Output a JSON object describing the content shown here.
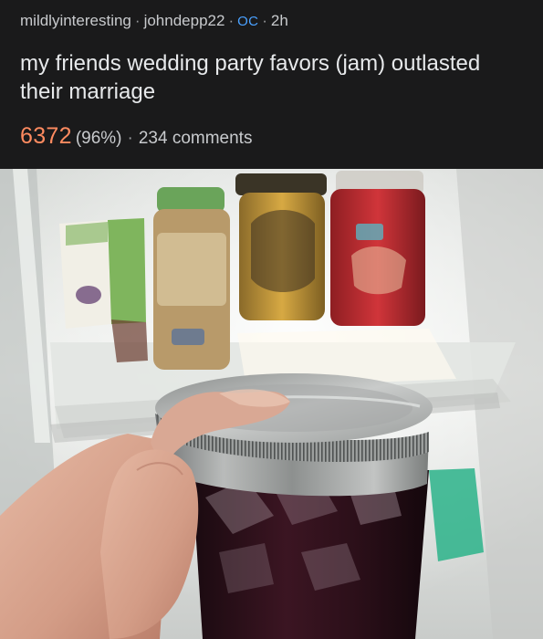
{
  "post": {
    "subreddit": "mildlyinteresting",
    "author": "johndepp22",
    "flair": "OC",
    "age": "2h",
    "separator": "·",
    "title": "my friends wedding party favors (jam) outlasted their marriage",
    "score": "6372",
    "upvote_ratio": "(96%)",
    "comments": "234 comments"
  },
  "image": {
    "subject": "hand holding a jar of jam in front of an open refrigerator",
    "colors": {
      "fridge_light": "#e9ebe8",
      "jam": "#2a0f1a",
      "lid": "#a7a9a8",
      "hand": "#d9a894"
    }
  }
}
